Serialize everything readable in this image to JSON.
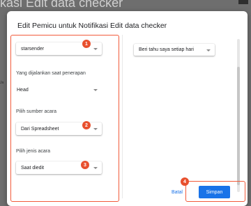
{
  "background": {
    "title_fragment": "kasi Edit data checker",
    "side_text": "Ja"
  },
  "dialog": {
    "title": "Edit Pemicu untuk Notifikasi Edit data checker",
    "function_select": {
      "value": "starsender"
    },
    "deployment_label": "Yang dijalankan saat penerapan",
    "deployment_select": {
      "value": "Head"
    },
    "event_source_label": "Pilih sumber acara",
    "event_source_select": {
      "value": "Dari Spreadsheet"
    },
    "event_type_label": "Pilih jenis acara",
    "event_type_select": {
      "value": "Saat diedit"
    },
    "failure_notification_select": {
      "value": "Beri tahu saya setiap hari"
    },
    "buttons": {
      "cancel": "Batal",
      "save": "Simpan"
    }
  },
  "badges": [
    "1",
    "2",
    "3",
    "4"
  ],
  "colors": {
    "accent": "#1a73e8",
    "highlight": "#f25a3a",
    "badge": "#e8502e"
  }
}
